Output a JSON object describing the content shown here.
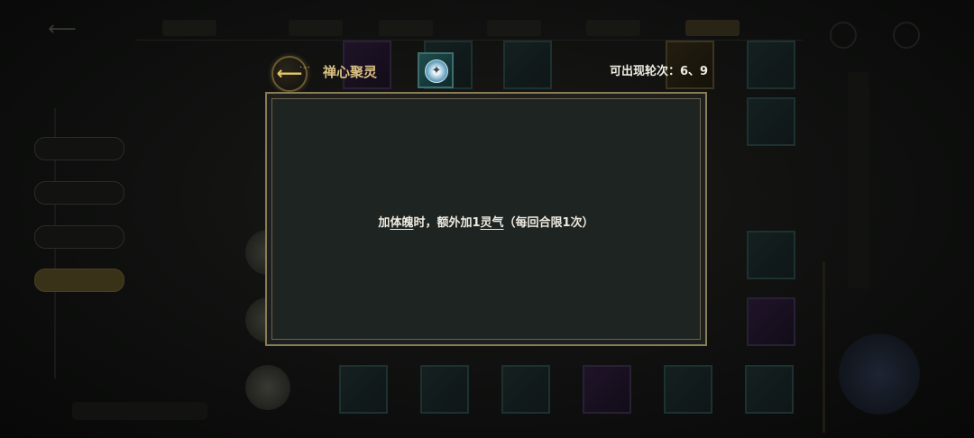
{
  "popup": {
    "title": "禅心聚灵",
    "rounds_label": "可出现轮次：6、9",
    "description": {
      "part1": "加",
      "keyword1": "体魄",
      "part2": "时，额外加1",
      "keyword2": "灵气",
      "part3": "（每回合限1次）"
    },
    "skill_icon": "spirit-orb-icon",
    "back_icon": "back-arrow-icon"
  },
  "colors": {
    "gold_accent": "#d9bf82",
    "panel_bg": "#1d2422",
    "panel_border": "#8a7a55",
    "text": "#eeeae0"
  }
}
